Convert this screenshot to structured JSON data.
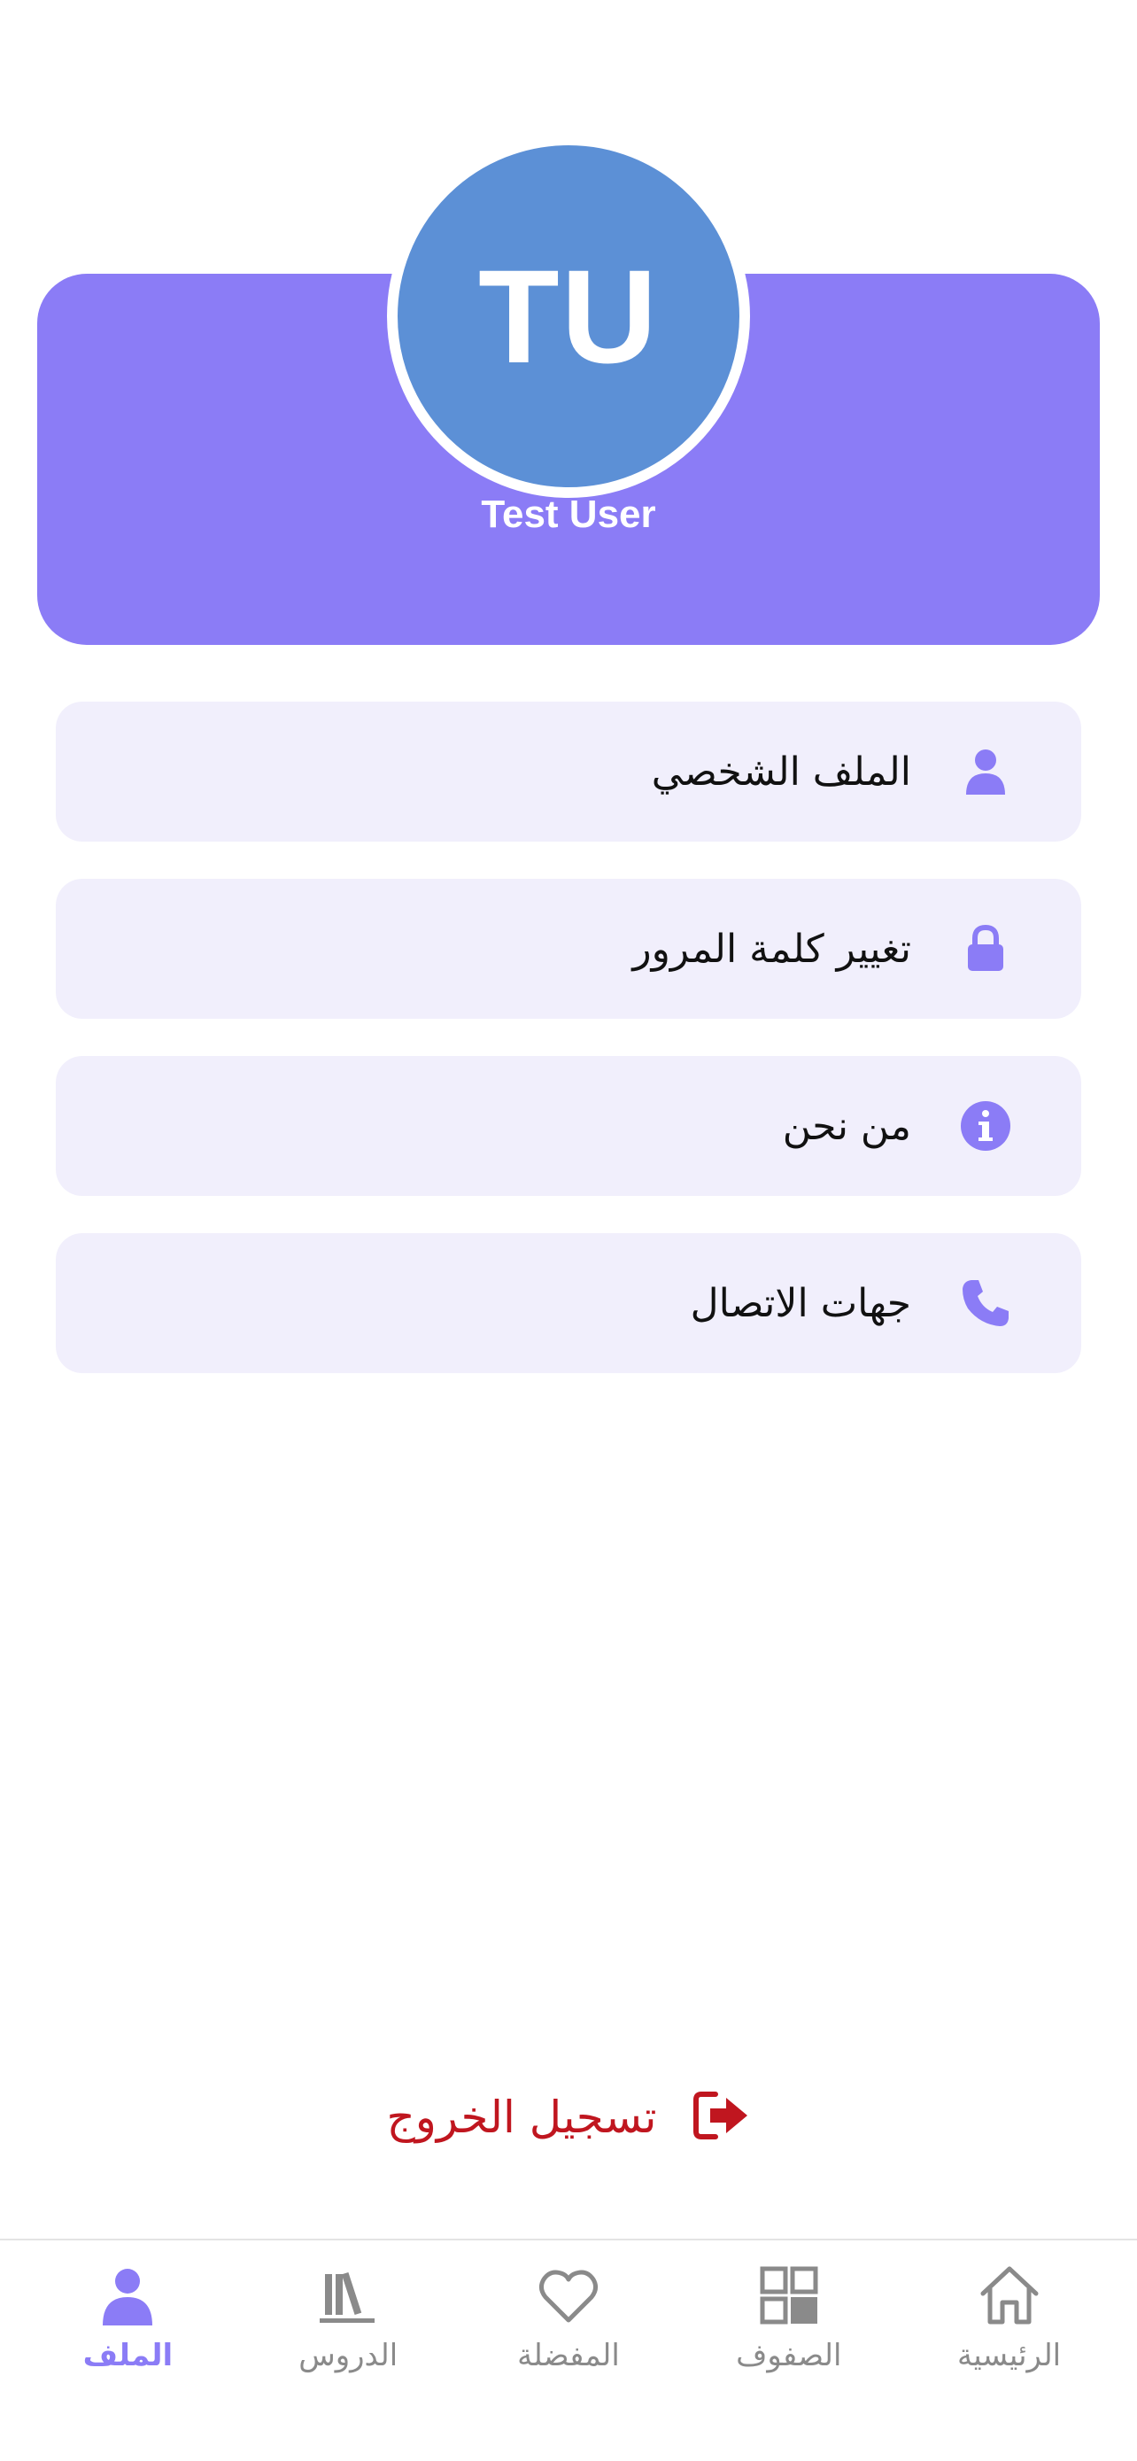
{
  "profile": {
    "initials": "TU",
    "name": "Test User"
  },
  "menu": {
    "items": [
      {
        "label": "الملف الشخصي",
        "icon": "person-icon"
      },
      {
        "label": "تغيير كلمة المرور",
        "icon": "lock-icon"
      },
      {
        "label": "من نحن",
        "icon": "info-icon"
      },
      {
        "label": "جهات الاتصال",
        "icon": "phone-icon"
      }
    ]
  },
  "logout": {
    "label": "تسجيل الخروج",
    "icon": "logout-icon"
  },
  "bottom_nav": {
    "items": [
      {
        "label": "الملف",
        "icon": "person-icon",
        "active": true
      },
      {
        "label": "الدروس",
        "icon": "books-icon",
        "active": false
      },
      {
        "label": "المفضلة",
        "icon": "heart-icon",
        "active": false
      },
      {
        "label": "الصفوف",
        "icon": "grid-icon",
        "active": false
      },
      {
        "label": "الرئيسية",
        "icon": "home-icon",
        "active": false
      }
    ]
  },
  "colors": {
    "accent": "#8b7cf6",
    "avatar_bg": "#5c90d6",
    "menu_bg": "#f1effc",
    "logout": "#c0161f",
    "nav_inactive": "#8a8a8a"
  }
}
